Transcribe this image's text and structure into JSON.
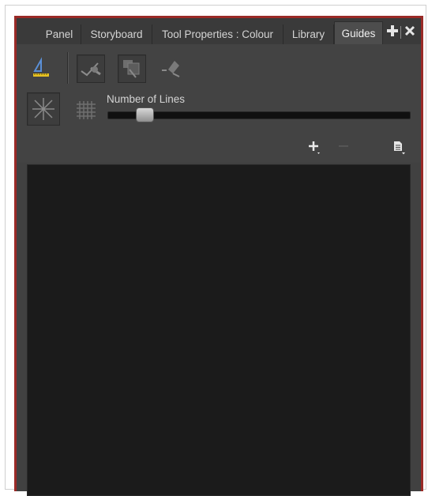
{
  "tabs": [
    {
      "label": "Panel",
      "active": false
    },
    {
      "label": "Storyboard",
      "active": false
    },
    {
      "label": "Tool Properties : Colour",
      "active": false
    },
    {
      "label": "Library",
      "active": false
    },
    {
      "label": "Guides",
      "active": true
    }
  ],
  "tab_controls": {
    "add_icon": "plus-icon",
    "close_icon": "close-icon"
  },
  "tools": {
    "ruler": "ruler-guide-icon",
    "align_with_guide": "align-guide-icon",
    "lock_guide": "lock-guide-icon",
    "shift_guide": "shift-guide-icon",
    "vanishing_lines": "radial-lines-icon",
    "grid": "grid-icon"
  },
  "slider": {
    "label": "Number of Lines",
    "value_fraction": 0.1
  },
  "list_controls": {
    "add": "plus-icon",
    "remove": "minus-icon",
    "menu": "menu-icon"
  },
  "colors": {
    "accent_border": "#9a2a27",
    "panel_bg": "#414141",
    "list_bg": "#1b1b1b"
  }
}
